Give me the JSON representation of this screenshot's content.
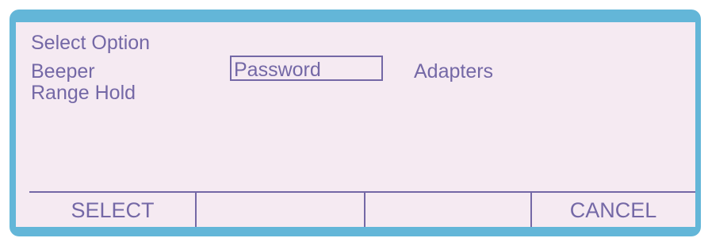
{
  "menu": {
    "title": "Select  Option",
    "items": [
      {
        "label": "Beeper"
      },
      {
        "label": "Password",
        "selected": true
      },
      {
        "label": "Adapters"
      },
      {
        "label": "Range Hold"
      }
    ]
  },
  "softkeys": [
    {
      "label": "SELECT"
    },
    {
      "label": ""
    },
    {
      "label": ""
    },
    {
      "label": "CANCEL"
    }
  ],
  "colors": {
    "frame": "#63b6d8",
    "screen": "#f5eaf2",
    "text": "#7468a6"
  }
}
